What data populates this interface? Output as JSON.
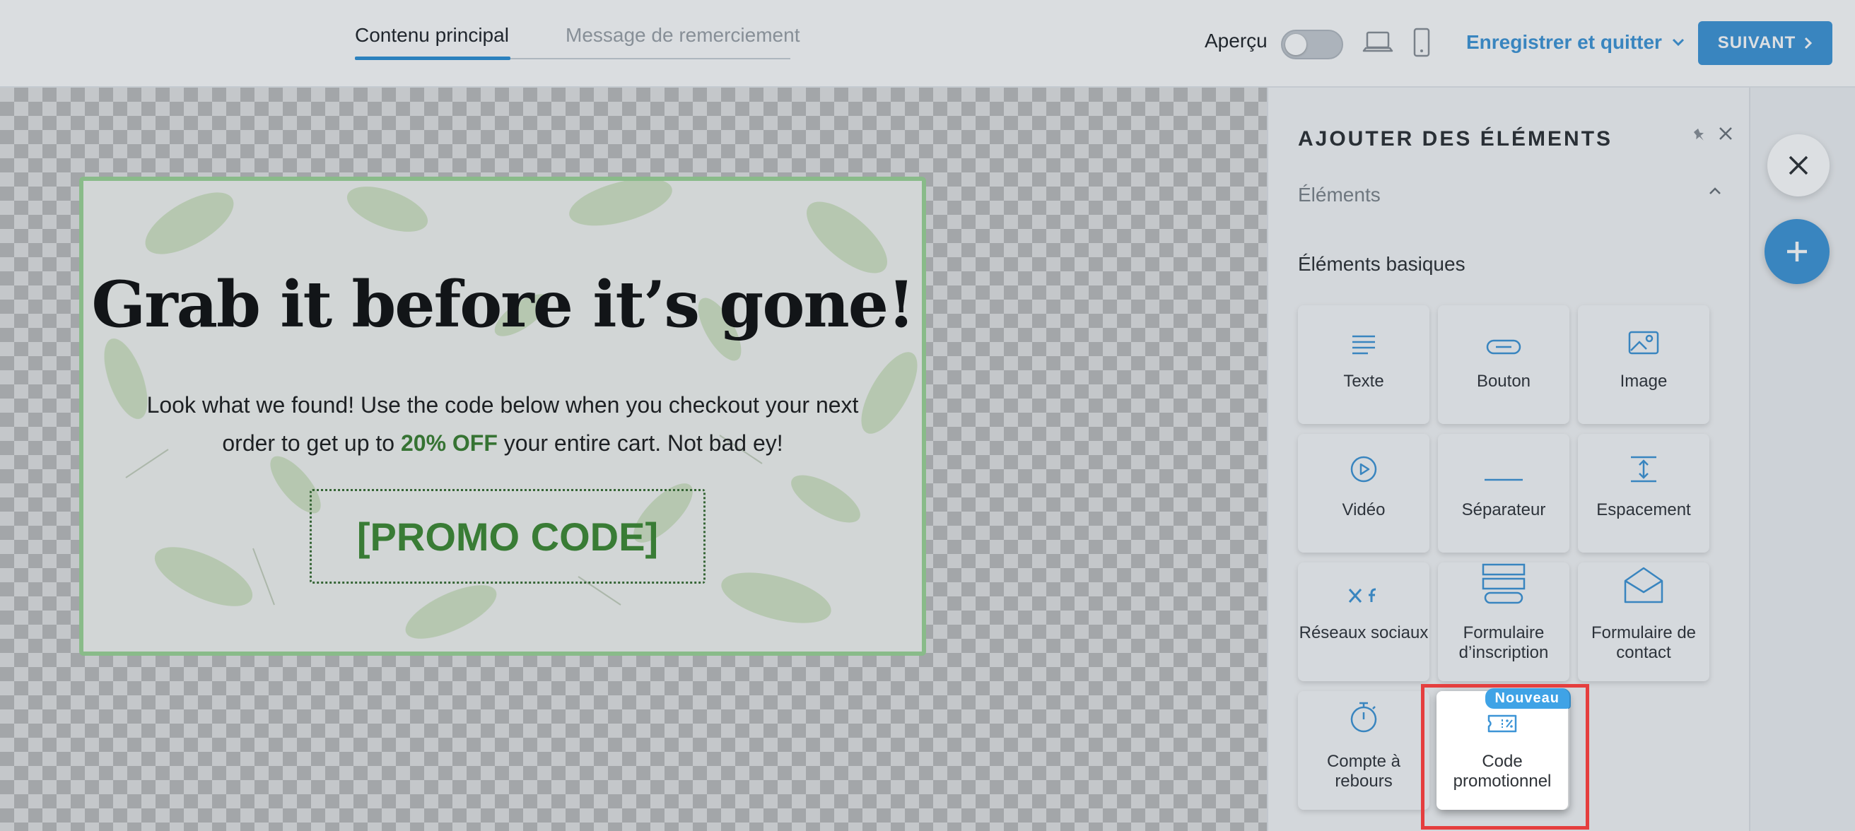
{
  "header": {
    "tabs": [
      {
        "label": "Contenu principal",
        "active": true
      },
      {
        "label": "Message de remerciement",
        "active": false
      }
    ],
    "preview_label": "Aperçu",
    "preview_enabled": false,
    "save_quit_label": "Enregistrer et quitter",
    "next_label": "SUIVANT"
  },
  "popup": {
    "title": "Grab it before it’s gone!",
    "body_part1": "Look what we found! Use the code below when you checkout your next order to get up to ",
    "body_highlight": "20% OFF",
    "body_part2": " your entire cart. Not bad ey!",
    "promo_code": "[PROMO CODE]",
    "accent_color": "#3d8a32"
  },
  "panel": {
    "title": "AJOUTER DES ÉLÉMENTS",
    "section": "Éléments",
    "subsection": "Éléments basiques",
    "tiles": [
      {
        "label": "Texte",
        "icon": "text-icon"
      },
      {
        "label": "Bouton",
        "icon": "button-icon"
      },
      {
        "label": "Image",
        "icon": "image-icon"
      },
      {
        "label": "Vidéo",
        "icon": "video-icon"
      },
      {
        "label": "Séparateur",
        "icon": "separator-icon"
      },
      {
        "label": "Espacement",
        "icon": "spacing-icon"
      },
      {
        "label": "Réseaux sociaux",
        "icon": "social-icon"
      },
      {
        "label": "Formulaire d’inscription",
        "icon": "signup-form-icon"
      },
      {
        "label": "Formulaire de contact",
        "icon": "contact-form-icon"
      },
      {
        "label": "Compte à rebours",
        "icon": "countdown-icon"
      },
      {
        "label": "Code promotionnel",
        "icon": "promo-code-icon",
        "badge": "Nouveau"
      }
    ]
  },
  "colors": {
    "accent": "#3d94d6",
    "highlight_frame": "#e53e3e",
    "popup_border": "#9cd596"
  }
}
